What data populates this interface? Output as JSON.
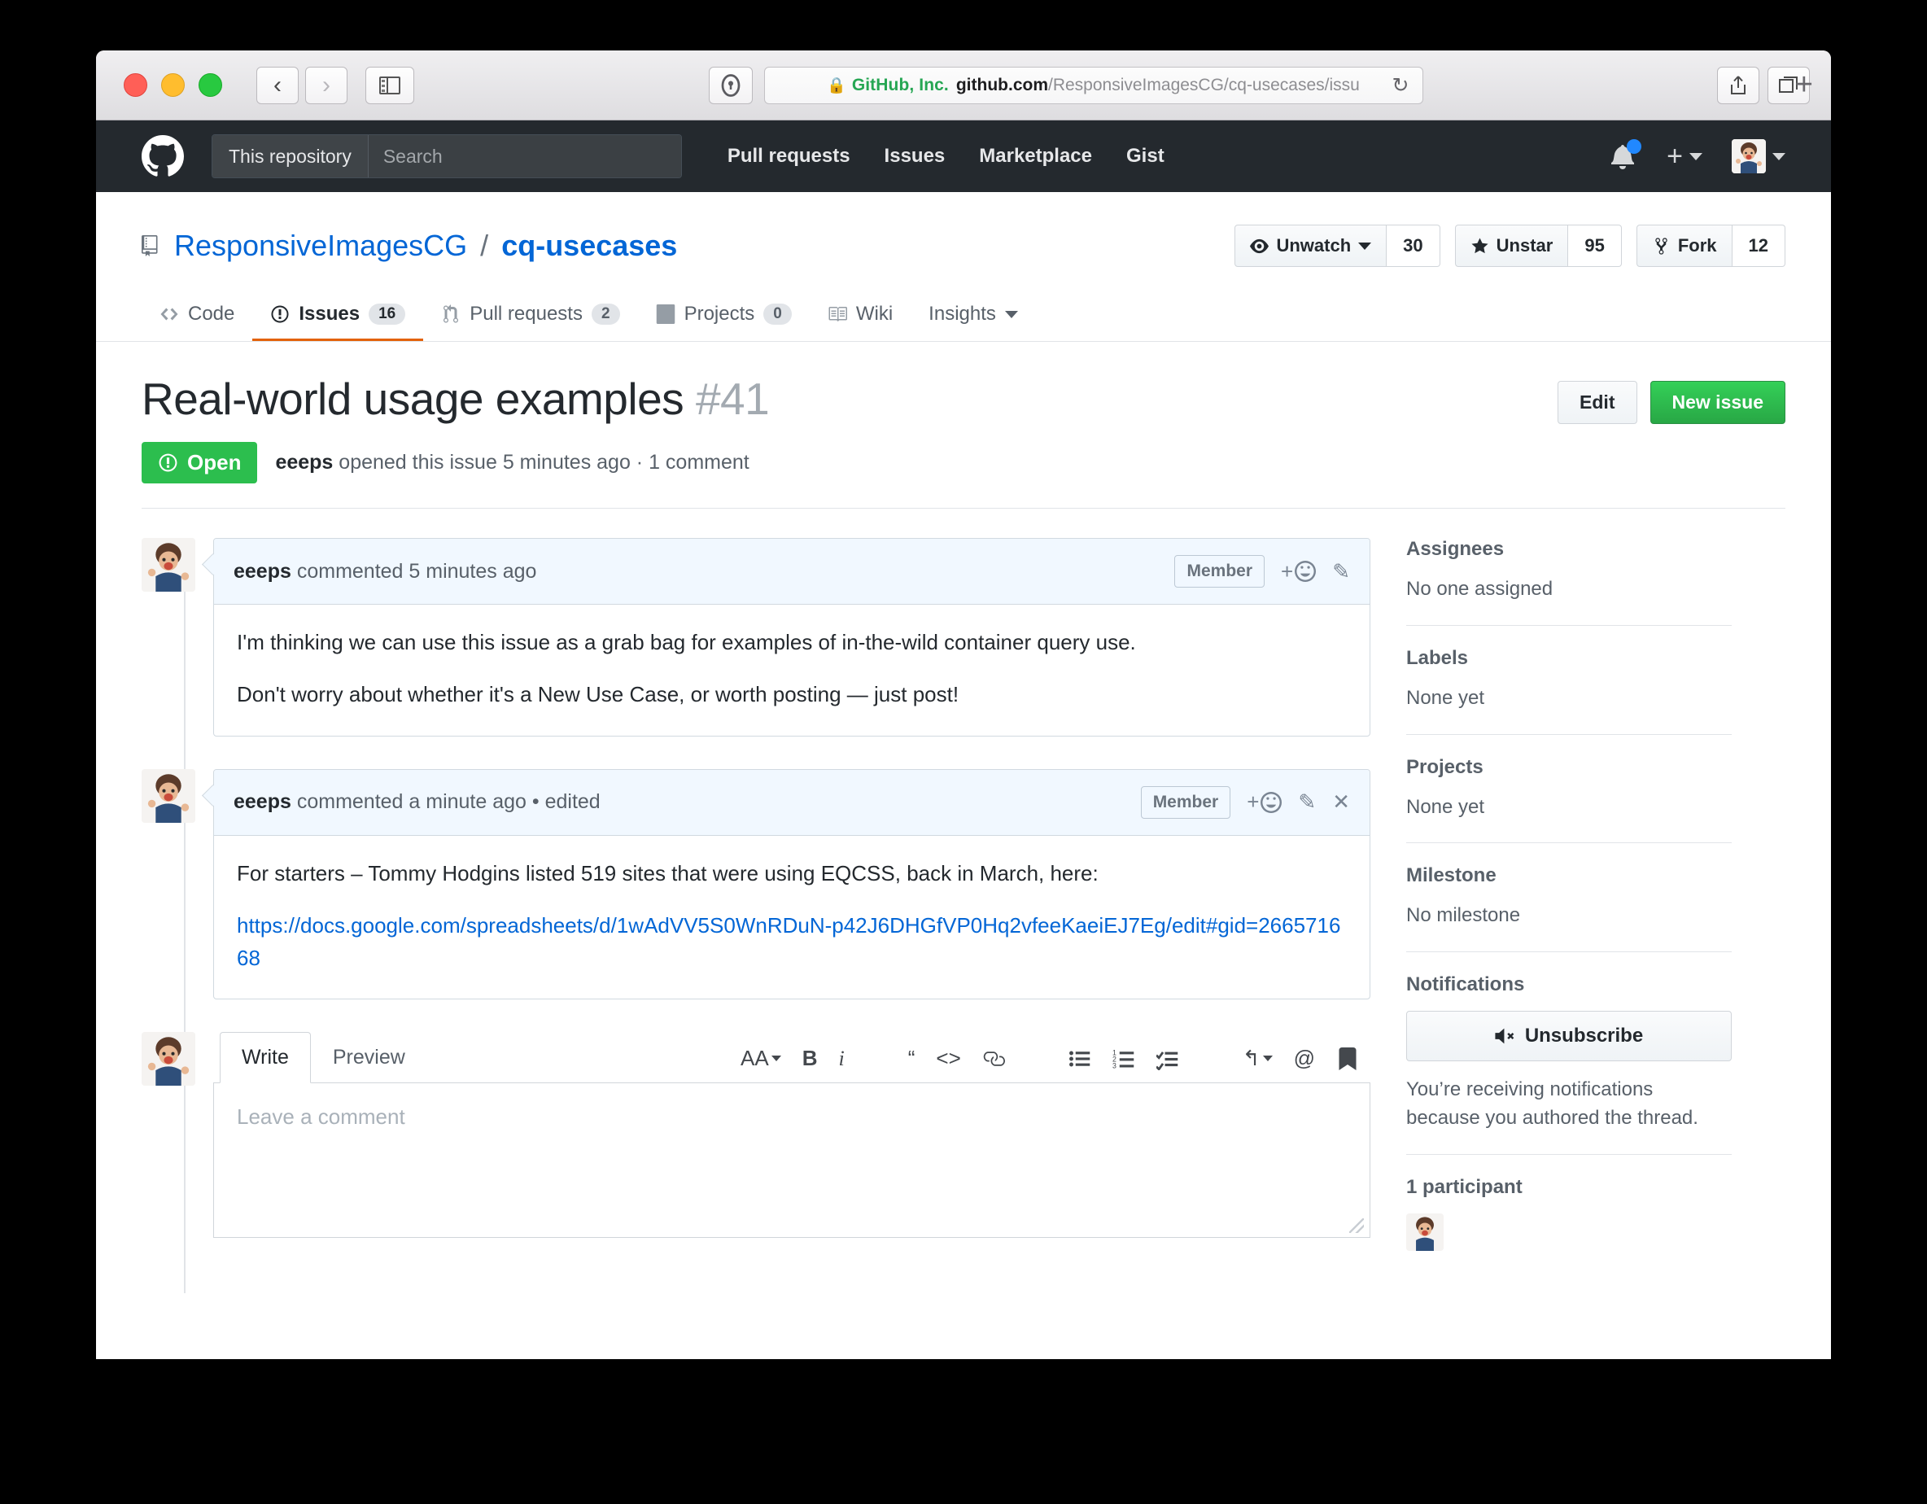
{
  "browser": {
    "back_icon": "back-chevron-icon",
    "forward_icon": "forward-chevron-icon",
    "sidebar_icon": "sidebar-toggle-icon",
    "password_icon": "1password-icon",
    "url_org": "GitHub, Inc.",
    "url_host": "github.com",
    "url_path": "/ResponsiveImagesCG/cq-usecases/issu",
    "reload_icon": "reload-icon",
    "share_icon": "share-icon",
    "tabs_icon": "show-tabs-icon",
    "new_tab_icon": "new-tab-plus-icon"
  },
  "gh_header": {
    "logo": "github-octocat-logo",
    "scope_label": "This repository",
    "search_placeholder": "Search",
    "nav": [
      "Pull requests",
      "Issues",
      "Marketplace",
      "Gist"
    ],
    "notification_icon": "bell-icon",
    "create_new_icon": "plus-icon",
    "profile_icon": "user-avatar"
  },
  "repo": {
    "owner": "ResponsiveImagesCG",
    "separator": "/",
    "name": "cq-usecases",
    "book_icon": "repo-book-icon",
    "actions": [
      {
        "label": "Unwatch",
        "count": "30",
        "icon": "eye-icon",
        "has_caret": true
      },
      {
        "label": "Unstar",
        "count": "95",
        "icon": "star-icon",
        "has_caret": false
      },
      {
        "label": "Fork",
        "count": "12",
        "icon": "fork-icon",
        "has_caret": false
      }
    ],
    "tabs": [
      {
        "label": "Code",
        "count": null,
        "icon": "code-icon",
        "active": false
      },
      {
        "label": "Issues",
        "count": "16",
        "icon": "issue-opened-icon",
        "active": true
      },
      {
        "label": "Pull requests",
        "count": "2",
        "icon": "git-pull-request-icon",
        "active": false
      },
      {
        "label": "Projects",
        "count": "0",
        "icon": "project-board-icon",
        "active": false
      },
      {
        "label": "Wiki",
        "count": null,
        "icon": "book-open-icon",
        "active": false
      },
      {
        "label": "Insights",
        "count": null,
        "icon": null,
        "active": false,
        "has_caret": true
      }
    ]
  },
  "issue": {
    "title": "Real-world usage examples",
    "number": "#41",
    "edit_label": "Edit",
    "new_issue_label": "New issue",
    "state": "Open",
    "state_icon": "issue-opened-icon",
    "meta_author": "eeeps",
    "meta_rest": " opened this issue 5 minutes ago · 1 comment"
  },
  "comments": [
    {
      "author": "eeeps",
      "meta": " commented 5 minutes ago",
      "badge": "Member",
      "tools": [
        "add-reaction-icon",
        "edit-pencil-icon"
      ],
      "paragraphs": [
        "I'm thinking we can use this issue as a grab bag for examples of in-the-wild container query use.",
        "Don't worry about whether it's a New Use Case, or worth posting — just post!"
      ],
      "link": null
    },
    {
      "author": "eeeps",
      "meta": " commented a minute ago • edited",
      "badge": "Member",
      "tools": [
        "add-reaction-icon",
        "edit-pencil-icon",
        "close-x-icon"
      ],
      "paragraphs": [
        "For starters – Tommy Hodgins listed 519 sites that were using EQCSS, back in March, here:"
      ],
      "link": "https://docs.google.com/spreadsheets/d/1wAdVV5S0WnRDuN-p42J6DHGfVP0Hq2vfeeKaeiEJ7Eg/edit#gid=266571668"
    }
  ],
  "comment_form": {
    "tab_write": "Write",
    "tab_preview": "Preview",
    "placeholder": "Leave a comment",
    "toolbar": [
      "text-size-icon",
      "bold-icon",
      "italic-icon",
      "quote-icon",
      "code-icon",
      "link-icon",
      "unordered-list-icon",
      "ordered-list-icon",
      "task-list-icon",
      "reply-icon",
      "mention-icon",
      "saved-replies-icon"
    ]
  },
  "sidebar": {
    "sections": [
      {
        "title": "Assignees",
        "value": "No one assigned"
      },
      {
        "title": "Labels",
        "value": "None yet"
      },
      {
        "title": "Projects",
        "value": "None yet"
      },
      {
        "title": "Milestone",
        "value": "No milestone"
      }
    ],
    "notifications_title": "Notifications",
    "unsubscribe_label": "Unsubscribe",
    "unsubscribe_icon": "mute-icon",
    "notifications_note": "You’re receiving notifications because you authored the thread.",
    "participants_title": "1 participant"
  }
}
